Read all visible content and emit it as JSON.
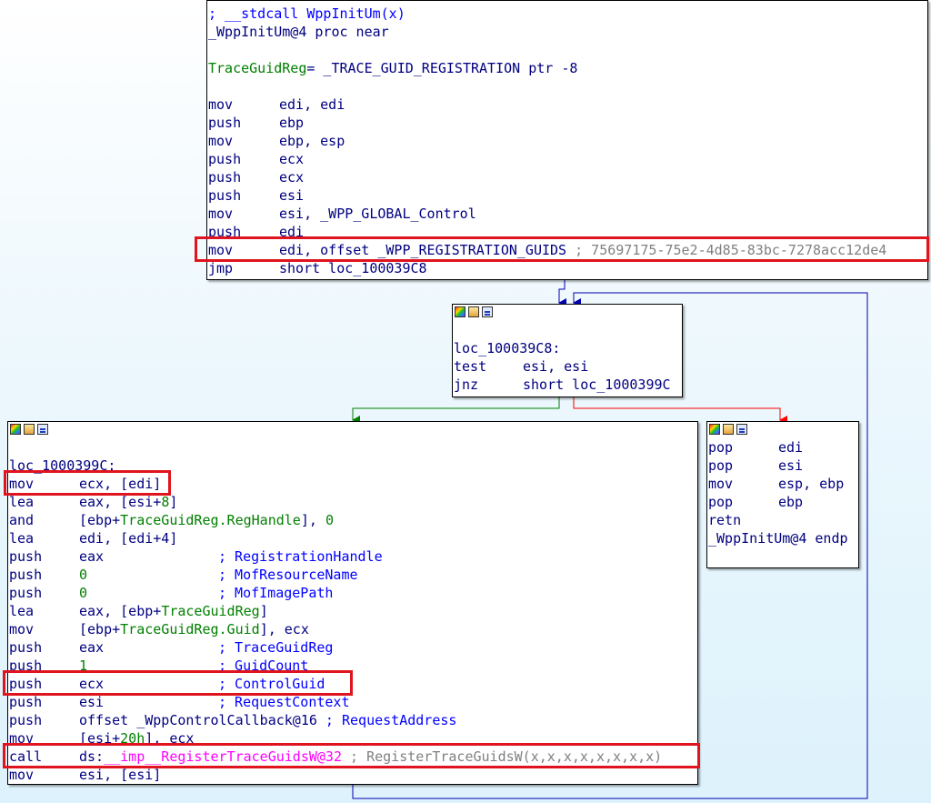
{
  "block_top": {
    "header_comment": "; __stdcall WppInitUm(x)",
    "proc_decl": "_WppInitUm@4 proc near",
    "var_name": "TraceGuidReg",
    "var_def": "= _TRACE_GUID_REGISTRATION ptr -8",
    "instr": [
      {
        "mn": "mov",
        "op": "edi, edi"
      },
      {
        "mn": "push",
        "op": "ebp"
      },
      {
        "mn": "mov",
        "op": "ebp, esp"
      },
      {
        "mn": "push",
        "op": "ecx"
      },
      {
        "mn": "push",
        "op": "ecx"
      },
      {
        "mn": "push",
        "op": "esi"
      },
      {
        "mn": "mov",
        "op_pre": "esi, ",
        "op_sym": "_WPP_GLOBAL_Control"
      },
      {
        "mn": "push",
        "op": "edi"
      },
      {
        "mn": "mov",
        "op_pre": "edi, offset ",
        "op_sym": "_WPP_REGISTRATION_GUIDS",
        "comment": "; 75697175-75e2-4d85-83bc-7278acc12de4"
      },
      {
        "mn": "jmp",
        "op": "short loc_100039C8"
      }
    ]
  },
  "block_mid": {
    "label": "loc_100039C8:",
    "instr": [
      {
        "mn": "test",
        "op": "esi, esi"
      },
      {
        "mn": "jnz",
        "op": "short loc_1000399C"
      }
    ]
  },
  "block_left": {
    "label": "loc_1000399C:",
    "instr": [
      {
        "mn": "mov",
        "op": "ecx, [edi]"
      },
      {
        "mn": "lea",
        "op_pre": "eax, [esi+",
        "op_num": "8",
        "op_post": "]"
      },
      {
        "mn": "and",
        "op_pre": "[ebp+",
        "op_sym": "TraceGuidReg.RegHandle",
        "op_post": "], ",
        "op_num2": "0"
      },
      {
        "mn": "lea",
        "op": "edi, [edi+4]"
      },
      {
        "mn": "push",
        "op": "eax",
        "comment": "; RegistrationHandle"
      },
      {
        "mn": "push",
        "op_num": "0",
        "comment": "; MofResourceName"
      },
      {
        "mn": "push",
        "op_num": "0",
        "comment": "; MofImagePath"
      },
      {
        "mn": "lea",
        "op_pre": "eax, [ebp+",
        "op_sym": "TraceGuidReg",
        "op_post": "]"
      },
      {
        "mn": "mov",
        "op_pre": "[ebp+",
        "op_sym": "TraceGuidReg.Guid",
        "op_post": "], ecx"
      },
      {
        "mn": "push",
        "op": "eax",
        "comment": "; TraceGuidReg"
      },
      {
        "mn": "push",
        "op_num": "1",
        "comment": "; GuidCount"
      },
      {
        "mn": "push",
        "op": "ecx",
        "comment": "; ControlGuid"
      },
      {
        "mn": "push",
        "op": "esi",
        "comment": "; RequestContext"
      },
      {
        "mn": "push",
        "op_pre": "offset ",
        "op_sym": "_WppControlCallback@16",
        "comment": " ; RequestAddress"
      },
      {
        "mn": "mov",
        "op_pre": "[esi+",
        "op_num": "20h",
        "op_post": "], ecx"
      },
      {
        "mn": "call",
        "op_pre": "ds:",
        "op_pink": "__imp__RegisterTraceGuidsW@32",
        "comment_gray": " ; RegisterTraceGuidsW(x,x,x,x,x,x,x,x)"
      },
      {
        "mn": "mov",
        "op": "esi, [esi]"
      }
    ]
  },
  "block_right": {
    "instr": [
      {
        "mn": "pop",
        "op": "edi"
      },
      {
        "mn": "pop",
        "op": "esi"
      },
      {
        "mn": "mov",
        "op": "esp, ebp"
      },
      {
        "mn": "pop",
        "op": "ebp"
      },
      {
        "mn": "retn",
        "op": ""
      }
    ],
    "endp": "_WppInitUm@4 endp"
  },
  "colors": {
    "code": "#000080",
    "symbol": "#008000",
    "comment": "#0000ff",
    "comment_gray": "#808080",
    "import": "#ff00ff",
    "highlight": "#e0141e",
    "edge_true": "#008000",
    "edge_false": "#ff0000",
    "edge_flow": "#0000b0"
  },
  "icons": [
    "color-palette-icon",
    "edit-node-icon",
    "graph-icon"
  ]
}
